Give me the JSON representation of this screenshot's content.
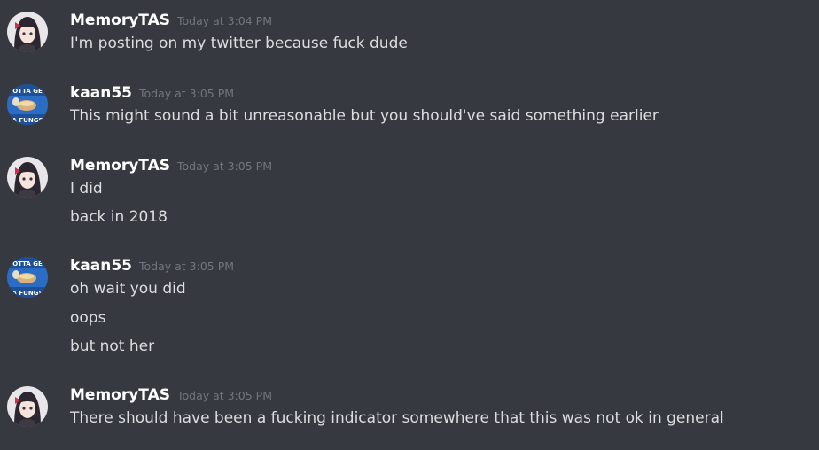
{
  "messages": [
    {
      "author": "MemoryTAS",
      "avatar_icon": "anime-girl-avatar-icon",
      "timestamp": "Today at 3:04 PM",
      "lines": [
        "I'm posting on my twitter because fuck dude"
      ]
    },
    {
      "author": "kaan55",
      "avatar_icon": "meme-avatar-icon",
      "avatar_text": "OTTA GET ... A FUNGS",
      "timestamp": "Today at 3:05 PM",
      "lines": [
        "This might sound a bit unreasonable but you should've said something earlier"
      ]
    },
    {
      "author": "MemoryTAS",
      "avatar_icon": "anime-girl-avatar-icon",
      "timestamp": "Today at 3:05 PM",
      "lines": [
        "I did",
        "back in 2018"
      ]
    },
    {
      "author": "kaan55",
      "avatar_icon": "meme-avatar-icon",
      "avatar_text": "OTTA GET ... A FUNGS",
      "timestamp": "Today at 3:05 PM",
      "lines": [
        "oh wait you did",
        "oops",
        "but not her"
      ]
    },
    {
      "author": "MemoryTAS",
      "avatar_icon": "anime-girl-avatar-icon",
      "timestamp": "Today at 3:05 PM",
      "lines": [
        "There should have been a fucking indicator somewhere that this was not ok in general"
      ]
    }
  ],
  "colors": {
    "background": "#36393f",
    "username": "#ffffff",
    "timestamp": "#72767d",
    "message_text": "#dcddde"
  }
}
